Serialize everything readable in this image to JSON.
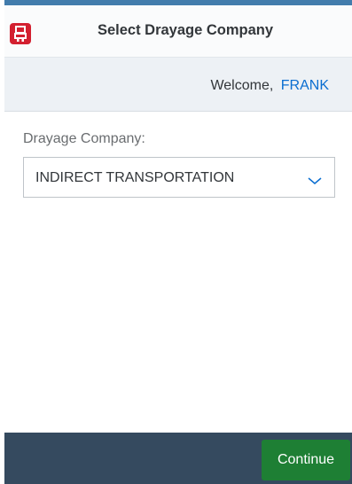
{
  "app": {
    "icon": "truck-icon",
    "title": "Select Drayage Company"
  },
  "welcome": {
    "label": "Welcome,",
    "user": "FRANK"
  },
  "form": {
    "company_label": "Drayage Company:",
    "company_value": "INDIRECT TRANSPORTATION",
    "dropdown_icon": "chevron-down-icon"
  },
  "footer": {
    "continue_label": "Continue"
  },
  "colors": {
    "accent": "#427cac",
    "app_icon_bg": "#d32030",
    "user_link": "#0a6ed1",
    "footer_bg": "#354a5f",
    "continue_bg": "#1e7f34"
  }
}
